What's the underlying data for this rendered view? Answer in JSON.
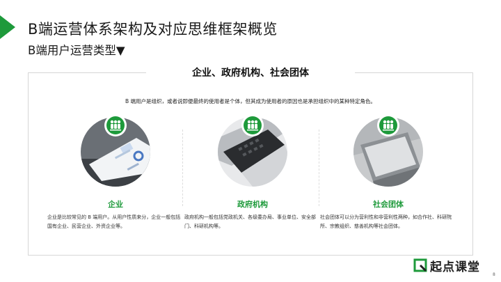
{
  "slide": {
    "title": "B端运营体系架构及对应思维框架概览",
    "subtitle": "B端用户运营类型▼",
    "frame_heading": "企业、政府机构、社会团体",
    "intro": "B 端用户是组织，或者说即便最终的使用者是个体，但其成为使用者的原因也是承担组织中的某种特定角色。",
    "page_number": "8",
    "accent_color": "#1e9a3b"
  },
  "columns": [
    {
      "title": "企业",
      "description": "企业是比较常见的 B 端用户。从用户性质来分，企业一般包括国有企业、民营企业、外资企业等。",
      "icon": "people-group-icon"
    },
    {
      "title": "政府机构",
      "description": "政府机构一般包括党政机关、各级委办局、事业单位、安全部门、科研机构等。",
      "icon": "people-group-icon"
    },
    {
      "title": "社会团体",
      "description": "社会团体可以分为营利性和非营利性两种，如合作社、科研院所、宗教组织、慈善机构等社会团体。",
      "icon": "people-group-icon"
    }
  ],
  "logo": {
    "text": "起点课堂",
    "icon": "qidian-logo-icon"
  }
}
